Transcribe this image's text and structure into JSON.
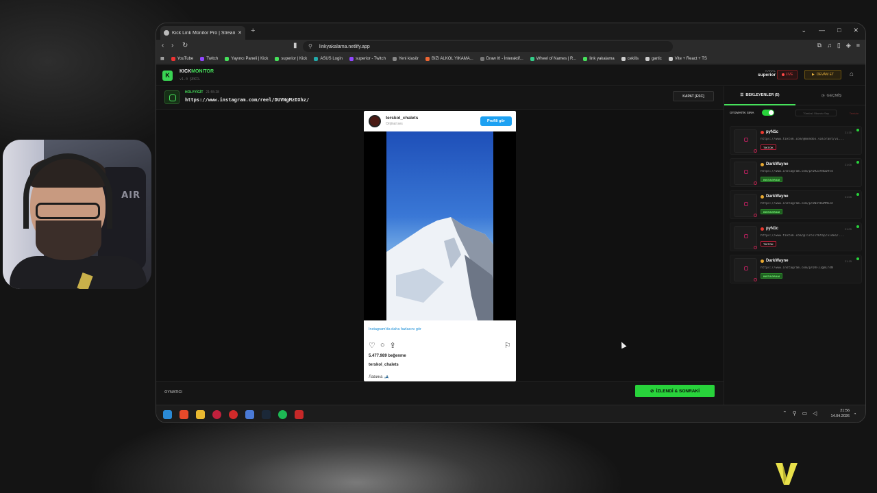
{
  "browser": {
    "tab_title": "Kick Link Monitor Pro | Stream",
    "url": "linkyakalama.netlify.app",
    "bookmarks": [
      "YouTube",
      "Twitch",
      "Yayıncı Paneli | Kick",
      "superior | Kick",
      "ASUS Login",
      "superior - Twitch",
      "Yeni klasör",
      "BIZI ALKOL YIKAMA...",
      "Draw It! - İnteraktif...",
      "Wheel of Names | R...",
      "link yakalama",
      "cekilis",
      "gartic",
      "Vite + React + TS"
    ]
  },
  "app": {
    "logo_letter": "K",
    "brand_kick": "KICK",
    "brand_monitor": "MONITOR",
    "version": "v1.0 ŞEKİL",
    "kanal_label": "KANAL",
    "kanal_value": "superior",
    "live_label": "LIVE",
    "devam_label": "DEVAM ET"
  },
  "current_link": {
    "submitter": "HOLYYİGİT",
    "time": "21:55:28",
    "url": "https://www.instagram.com/reel/DUVNgMzDXhz/",
    "close_label": "KAPAT [ESC]"
  },
  "embed": {
    "username": "terskol_chalets",
    "audio": "Orijinal ses",
    "profile_button": "Profili gör",
    "more_link": "Instagram'da daha fazlasını gör",
    "likes": "5.477.989 beğenme",
    "username2": "terskol_chalets",
    "caption": "Лавина 🎿"
  },
  "footer": {
    "player_label": "OYNATICI",
    "watched_button": "İZLENDİ & SONRAKİ"
  },
  "panel": {
    "tab_waiting": "BEKLEYENLER (5)",
    "tab_history": "GEÇMİŞ",
    "auto_label": "OTOMATİK SIRA",
    "mark_all": "Tümünü Okundu Say",
    "clear_all": "Temizle",
    "queue": [
      {
        "name": "pyN1c",
        "time": "21:35",
        "url": "https://www.tiktok.com/@mondox.valorant/vi...",
        "platform": "TIKTOK",
        "dot_color": "#e8392f"
      },
      {
        "name": "DarkWayne",
        "time": "21:05",
        "url": "https://www.instagram.com/p/DR2x946DVv4",
        "platform": "INSTAGRAM",
        "dot_color": "#e8a830"
      },
      {
        "name": "DarkWayne",
        "time": "21:05",
        "url": "https://www.instagram.com/p/DW3t8uMM52X",
        "platform": "INSTAGRAM",
        "dot_color": "#e8a830"
      },
      {
        "name": "pyN1c",
        "time": "21:05",
        "url": "https://www.tiktok.com/@lirolitktop/video/...",
        "platform": "TIKTOK",
        "dot_color": "#e8392f"
      },
      {
        "name": "DarkWayne",
        "time": "21:15",
        "url": "https://www.instagram.com/p/DXFI1gmCr4N",
        "platform": "INSTAGRAM",
        "dot_color": "#e8a830"
      }
    ]
  },
  "taskbar": {
    "time": "21:56",
    "date": "14.04.2026"
  },
  "webcam": {
    "chair_brand": "AIR"
  },
  "colors": {
    "accent": "#46e15b",
    "live": "#ff4747",
    "devam": "#f0b840"
  }
}
